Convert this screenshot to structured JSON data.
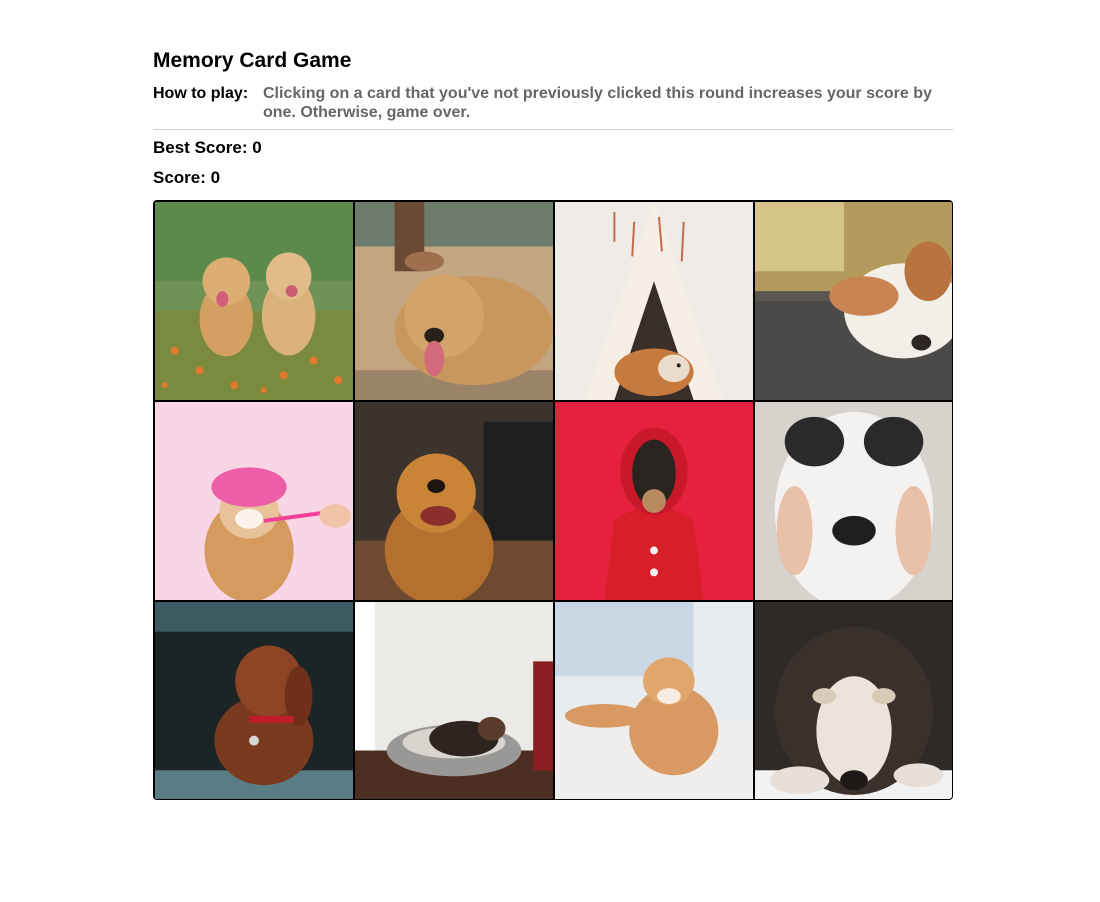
{
  "title": "Memory Card Game",
  "how_to": {
    "label": "How to play:",
    "text": "Clicking on a card that you've not previously clicked this round increases your score by one. Otherwise, game over."
  },
  "best_score": {
    "label": "Best Score:",
    "value": 0
  },
  "score": {
    "label": "Score:",
    "value": 0
  },
  "cards": [
    {
      "id": "two-golden-puppies-on-grass",
      "bg": "#6b8e4e"
    },
    {
      "id": "golden-retriever-lying-on-pavement",
      "bg": "#b69674"
    },
    {
      "id": "shiba-in-white-teepee",
      "bg": "#ece6df"
    },
    {
      "id": "dog-sleeping-on-blanket",
      "bg": "#b8a06a"
    },
    {
      "id": "shiba-with-pink-shower-cap",
      "bg": "#f7d7e6"
    },
    {
      "id": "golden-retriever-smiling-indoors",
      "bg": "#3a3028"
    },
    {
      "id": "dachshund-in-red-hoodie",
      "bg": "#e4223a"
    },
    {
      "id": "husky-face-held-by-hands",
      "bg": "#d4cec8"
    },
    {
      "id": "vizsla-in-car-window",
      "bg": "#2c3a3c"
    },
    {
      "id": "dog-in-grey-bed",
      "bg": "#e7e5e2"
    },
    {
      "id": "shiba-puppy-on-fluffy-rug",
      "bg": "#dfe5ea"
    },
    {
      "id": "malamute-puppy-lying-down",
      "bg": "#3c3430"
    }
  ]
}
